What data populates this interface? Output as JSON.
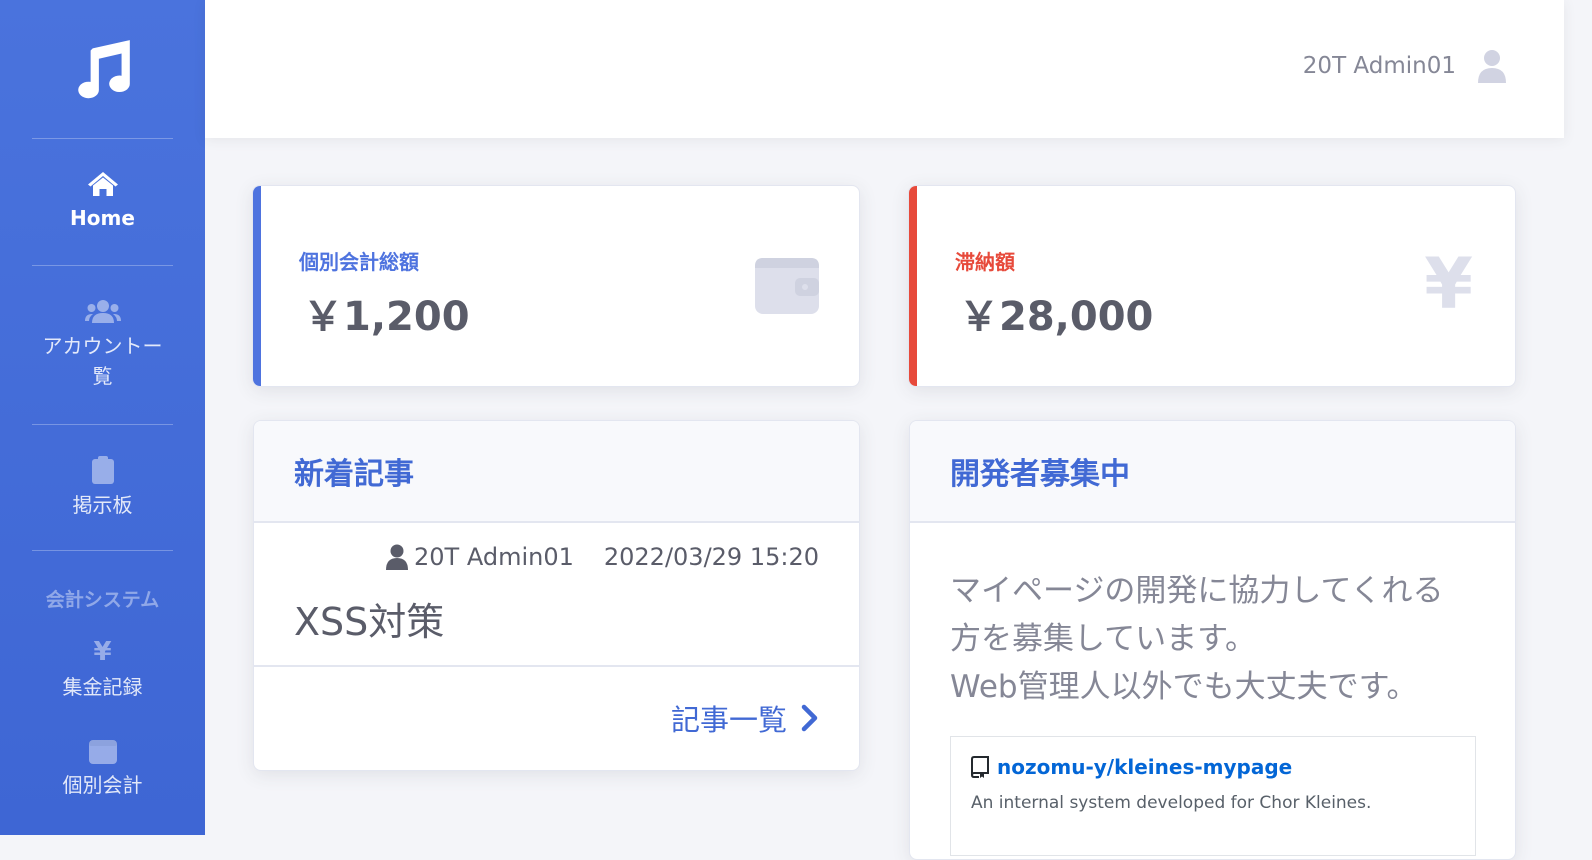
{
  "sidebar": {
    "brand_icon": "music-note-icon",
    "items": [
      {
        "label": "Home",
        "icon": "home-icon"
      },
      {
        "label_line1": "アカウントー",
        "label_line2": "覧",
        "icon": "users-icon"
      },
      {
        "label": "掲示板",
        "icon": "clipboard-icon"
      },
      {
        "label": "集金記録",
        "icon": "yen-icon"
      },
      {
        "label": "個別会計",
        "icon": "wallet-icon"
      }
    ],
    "section_heading": "会計システム"
  },
  "topbar": {
    "user_name": "20T Admin01",
    "avatar_icon": "user-icon"
  },
  "stats": [
    {
      "label": "個別会計総額",
      "value": "￥1,200",
      "icon": "wallet-icon",
      "color": "#4e73df"
    },
    {
      "label": "滞納額",
      "value": "￥28,000",
      "icon": "yen-icon",
      "color": "#e74a3b"
    }
  ],
  "news": {
    "header": "新着記事",
    "author": "20T Admin01",
    "datetime": "2022/03/29 15:20",
    "title": "XSS対策",
    "link_label": "記事一覧"
  },
  "recruit": {
    "header": "開発者募集中",
    "lines": [
      "マイページの開発に協力してくれる",
      "方を募集しています。",
      "Web管理人以外でも大丈夫です。"
    ],
    "repo": {
      "name": "nozomu-y/kleines-mypage",
      "description": "An internal system developed for Chor Kleines."
    }
  },
  "colors": {
    "sidebar_bg": "#4e73df",
    "primary": "#4e73df",
    "danger": "#e74a3b",
    "text_gray": "#858796",
    "link_blue": "#0366d6"
  }
}
